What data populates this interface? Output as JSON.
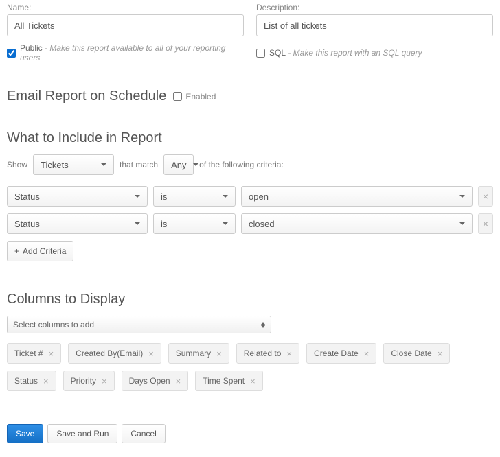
{
  "labels": {
    "name": "Name:",
    "description": "Description:",
    "public_strong": "Public",
    "public_desc": " - Make this report available to all of your reporting users",
    "sql_strong": "SQL",
    "sql_desc": " - Make this report with an SQL query",
    "email_heading": "Email Report on Schedule",
    "enabled": "Enabled",
    "include_heading": "What to Include in Report",
    "show": "Show",
    "that_match": "that match",
    "of_following": "of the following criteria:",
    "add_criteria": "Add Criteria",
    "columns_heading": "Columns to Display",
    "columns_placeholder": "Select columns to add",
    "save": "Save",
    "save_run": "Save and Run",
    "cancel": "Cancel"
  },
  "fields": {
    "name_value": "All Tickets",
    "description_value": "List of all tickets",
    "public_checked": true,
    "sql_checked": false,
    "schedule_enabled": false
  },
  "include": {
    "entity": "Tickets",
    "match_mode": "Any",
    "criteria": [
      {
        "field": "Status",
        "operator": "is",
        "value": "open"
      },
      {
        "field": "Status",
        "operator": "is",
        "value": "closed"
      }
    ]
  },
  "columns": [
    "Ticket #",
    "Created By(Email)",
    "Summary",
    "Related to",
    "Create Date",
    "Close Date",
    "Status",
    "Priority",
    "Days Open",
    "Time Spent"
  ]
}
